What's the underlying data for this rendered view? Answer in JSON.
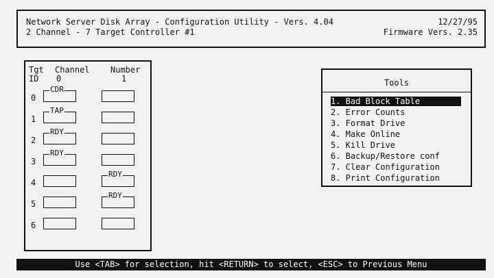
{
  "header": {
    "line1_left": "Network Server Disk Array - Configuration Utility - Vers. 4.04",
    "line1_right": "12/27/95",
    "line2_left": "2 Channel - 7 Target Controller #1",
    "line2_right": "Firmware Vers. 2.35"
  },
  "grid": {
    "head_tgt": "Tgt",
    "head_channel": "Channel",
    "head_number": "Number",
    "head_id": "ID",
    "col0": "0",
    "col1": "1",
    "rows": [
      {
        "id": "0",
        "c0": "CDR",
        "c1": ""
      },
      {
        "id": "1",
        "c0": "TAP",
        "c1": ""
      },
      {
        "id": "2",
        "c0": "RDY",
        "c1": ""
      },
      {
        "id": "3",
        "c0": "RDY",
        "c1": ""
      },
      {
        "id": "4",
        "c0": "",
        "c1": "RDY"
      },
      {
        "id": "5",
        "c0": "",
        "c1": "RDY"
      },
      {
        "id": "6",
        "c0": "",
        "c1": ""
      }
    ]
  },
  "tools": {
    "title": "Tools",
    "items": [
      "1. Bad Block Table",
      "2. Error Counts",
      "3. Format Drive",
      "4. Make Online",
      "5. Kill Drive",
      "6. Backup/Restore conf",
      "7. Clear Configuration",
      "8. Print Configuration"
    ],
    "selected_index": 0
  },
  "status": {
    "text": "Use <TAB> for selection, hit <RETURN> to select, <ESC> to Previous Menu"
  }
}
